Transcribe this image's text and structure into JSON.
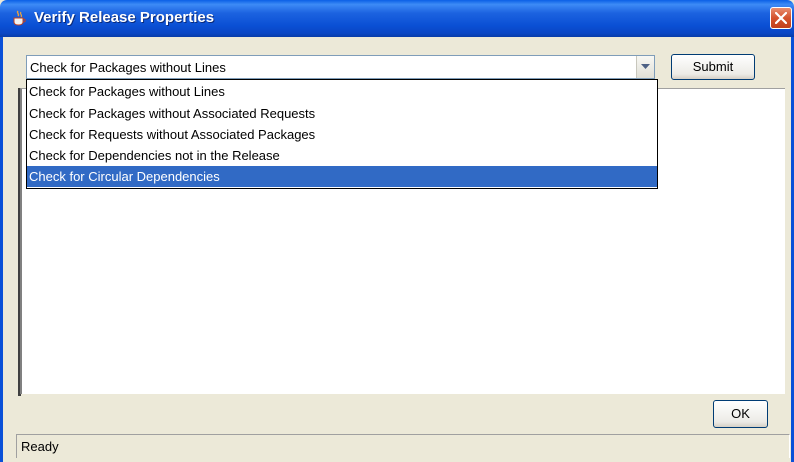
{
  "window": {
    "title": "Verify Release Properties",
    "icon": "java-cup-icon",
    "close_icon": "close-icon"
  },
  "query": {
    "selected_value": "Check for Packages without Lines",
    "submit_label": "Submit",
    "options": [
      {
        "label": "Check for Packages without Lines",
        "selected": false
      },
      {
        "label": "Check for Packages without Associated Requests",
        "selected": false
      },
      {
        "label": "Check for Requests without Associated Packages",
        "selected": false
      },
      {
        "label": "Check for Dependencies not in the Release",
        "selected": false
      },
      {
        "label": "Check for Circular Dependencies",
        "selected": true
      }
    ]
  },
  "footer": {
    "ok_label": "OK",
    "status": "Ready"
  },
  "colors": {
    "title_bar": "#0a50d8",
    "selection": "#316ac5",
    "close_button": "#d4522c"
  }
}
